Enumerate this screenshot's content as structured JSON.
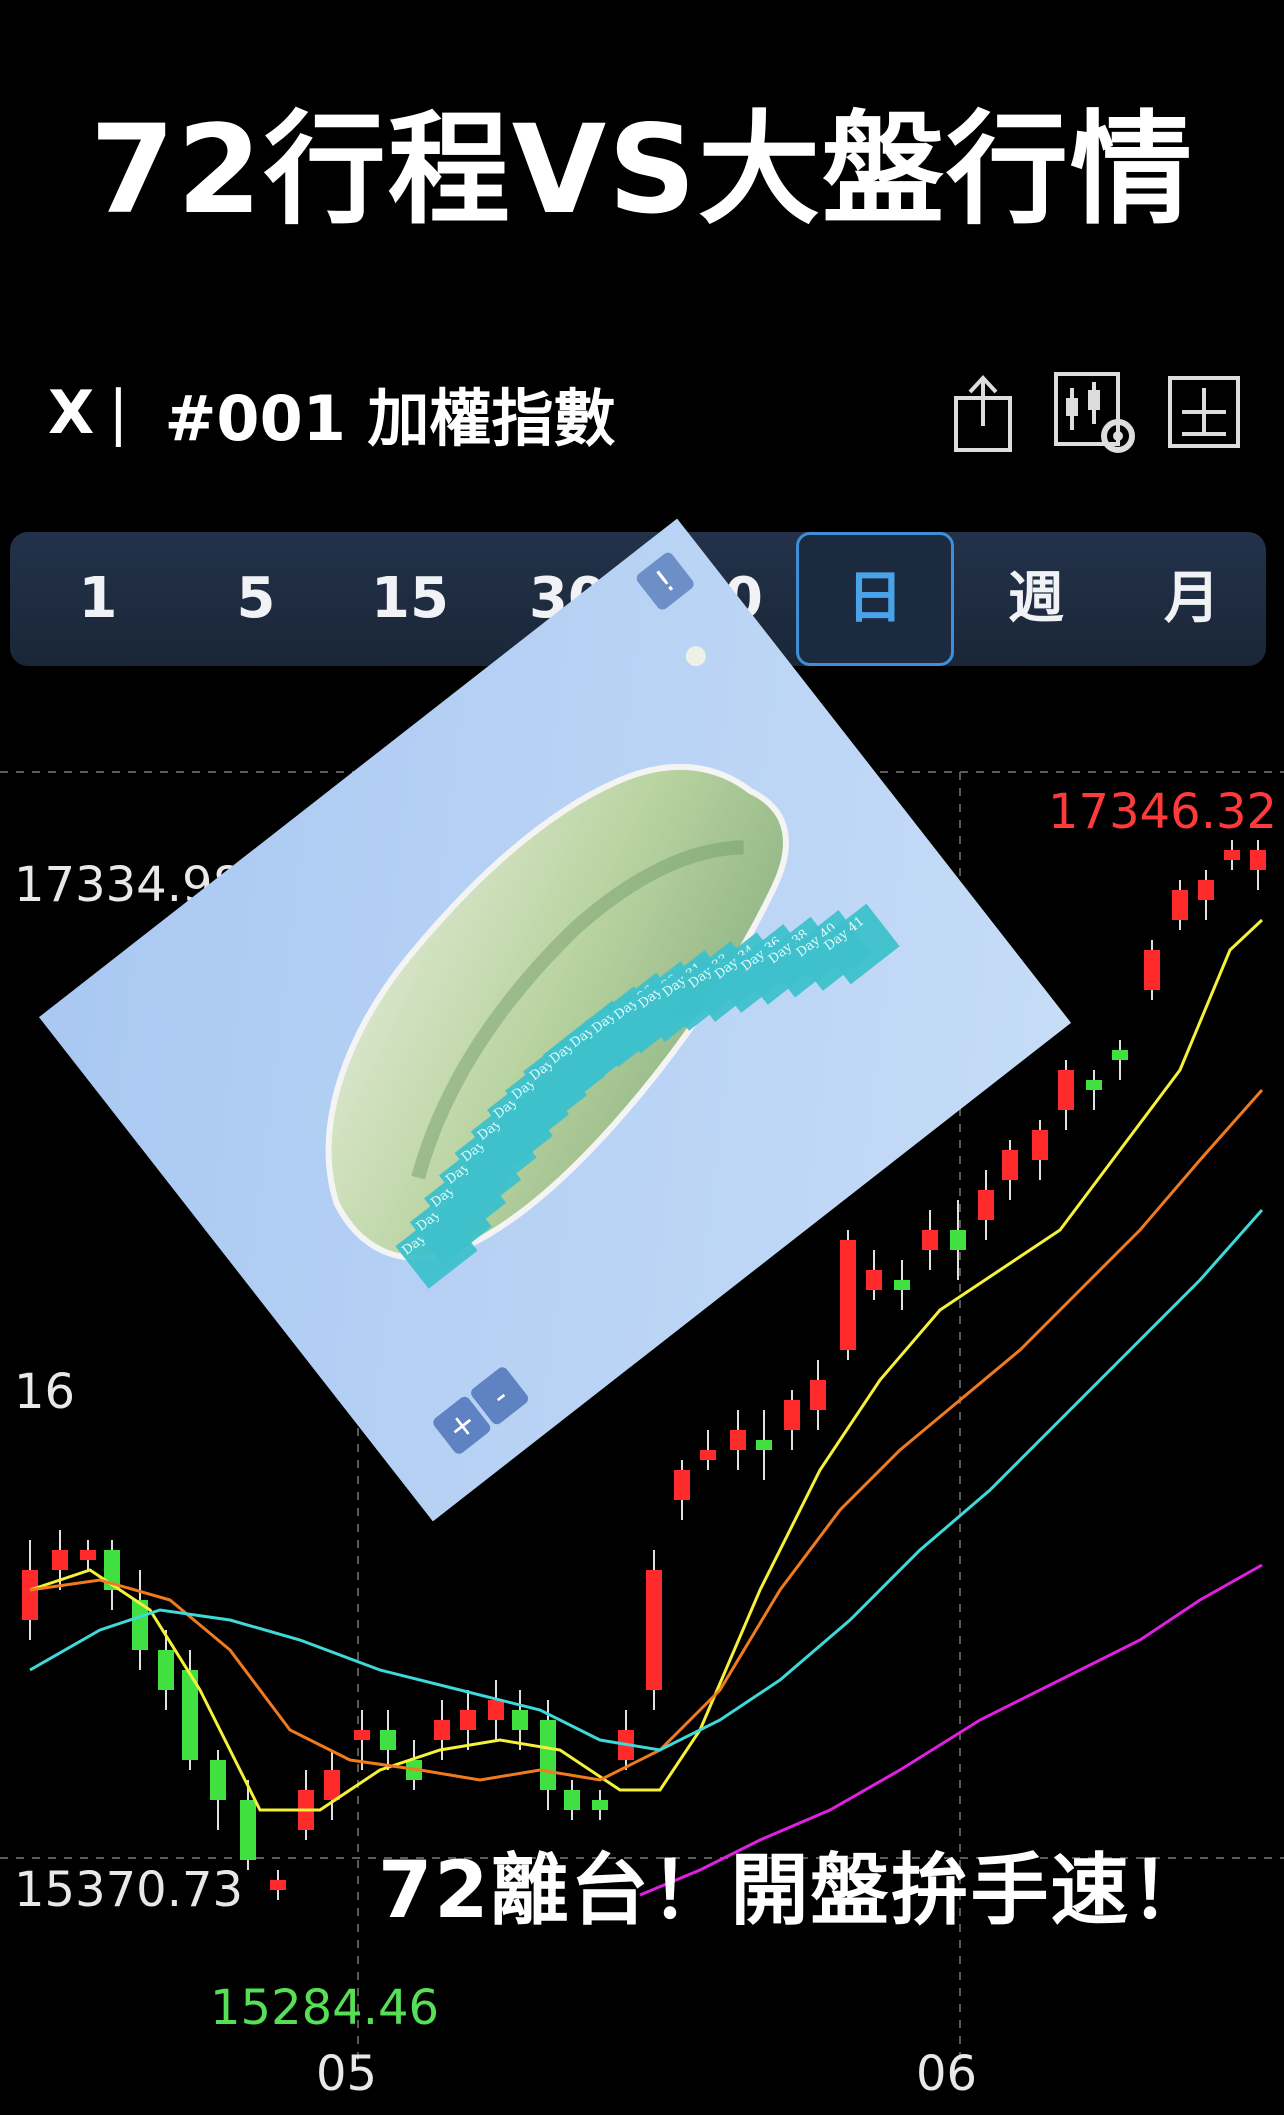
{
  "title": "72行程VS大盤行情",
  "header": {
    "close_label": "X",
    "separator": "|",
    "stock_name": "#001 加權指數",
    "icons": [
      "share-icon",
      "chart-settings-icon",
      "fullscreen-icon"
    ]
  },
  "tabs": [
    {
      "label": "1",
      "active": false
    },
    {
      "label": "5",
      "active": false
    },
    {
      "label": "15",
      "active": false
    },
    {
      "label": "30",
      "active": false
    },
    {
      "label": "60",
      "active": false
    },
    {
      "label": "日",
      "active": true
    },
    {
      "label": "週",
      "active": false
    },
    {
      "label": "月",
      "active": false
    }
  ],
  "price_labels": {
    "high_marker": "17346.32",
    "upper_level": "17334.98",
    "mid_level": "16",
    "lower_level": "15370.73",
    "low_marker": "15284.46"
  },
  "x_labels": [
    "05",
    "06"
  ],
  "map": {
    "day_labels": [
      "Day 7",
      "Day 8",
      "Day 9",
      "Day 10",
      "Day 13",
      "Day 15",
      "Day 16",
      "Day 17",
      "Day 18",
      "Day 21",
      "Day 23",
      "Day 25",
      "Day 26",
      "Day 29",
      "Day 31",
      "Day 33",
      "Day 34",
      "Day 36",
      "Day 38",
      "Day 40",
      "Day 41"
    ],
    "zoom_in": "+",
    "zoom_out": "-",
    "info_button": "!"
  },
  "caption": "72離台！開盤拚手速！",
  "colors": {
    "up": "#ff2a2a",
    "down": "#3fe03f",
    "ma5": "#f5f03a",
    "ma10": "#f07a1e",
    "ma20": "#3fd9d9",
    "ma60": "#e020e0",
    "tab_active": "#4aa3e8"
  }
}
